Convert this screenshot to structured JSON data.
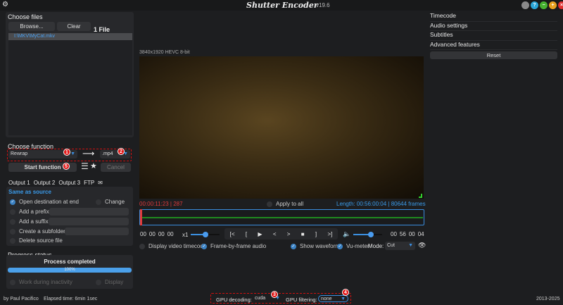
{
  "app": {
    "title": "Shutter Encoder",
    "version": "v19.6",
    "settings_icon": "gear-icon",
    "window_buttons": [
      {
        "name": "cloud",
        "color": "#8a8a8a"
      },
      {
        "name": "help",
        "label": "?",
        "color": "#2aa5d8"
      },
      {
        "name": "minimize",
        "color": "#46b030"
      },
      {
        "name": "maximize",
        "color": "#e8a020"
      },
      {
        "name": "close",
        "color": "#e03030"
      }
    ]
  },
  "files": {
    "title": "Choose files",
    "browse": "Browse...",
    "clear": "Clear",
    "count": "1 File",
    "items": [
      "I:\\MKV\\MyCat.mkv"
    ]
  },
  "function": {
    "title": "Choose function",
    "selected": "Rewrap",
    "container": ".mp4",
    "start": "Start function",
    "cancel": "Cancel",
    "badges": [
      "1",
      "2",
      "5"
    ]
  },
  "output": {
    "tabs": [
      "Output 1",
      "Output 2",
      "Output 3",
      "FTP"
    ],
    "destination": "Same as source",
    "open_dest": "Open destination at end",
    "change": "Change",
    "prefix": "Add a prefix:",
    "suffix": "Add a suffix:",
    "subfolder": "Create a subfolder:",
    "delete": "Delete source file"
  },
  "progress": {
    "title": "Progress status",
    "status": "Process completed",
    "percent": 100,
    "percent_label": "100%",
    "work_inactivity": "Work during inactivity",
    "display": "Display"
  },
  "footer": {
    "author": "by Paul Pacifico",
    "elapsed": "Elapsed time: 6min 1sec",
    "copyright": "2013-2025",
    "gpu_decoding_label": "GPU decoding:",
    "gpu_decoding": "cuda",
    "gpu_filtering_label": "GPU filtering:",
    "gpu_filtering": "none",
    "badges": [
      "3",
      "4"
    ]
  },
  "player": {
    "info": "3840x1920 HEVC 8-bit",
    "position": "00:00:11:23 | 287",
    "apply_all": "Apply to all",
    "length": "Length: 00:56:00:04 | 80644 frames",
    "tc_in": [
      "00",
      "00",
      "00",
      "00"
    ],
    "tc_out": [
      "00",
      "56",
      "00",
      "04"
    ],
    "speed": "x1",
    "speed_level": 0.5,
    "volume_level": 0.6,
    "controls": [
      "[<",
      "[",
      "▶",
      "<",
      ">",
      "■",
      "]",
      ">]"
    ],
    "display_tc": "Display video timecode",
    "frame_audio": "Frame-by-frame audio",
    "show_waveform": "Show waveform",
    "vu_meter": "Vu-meter",
    "mode_label": "Mode:",
    "mode": "Cut"
  },
  "right": {
    "sections": [
      "Timecode",
      "Audio settings",
      "Subtitles",
      "Advanced features"
    ],
    "reset": "Reset"
  }
}
